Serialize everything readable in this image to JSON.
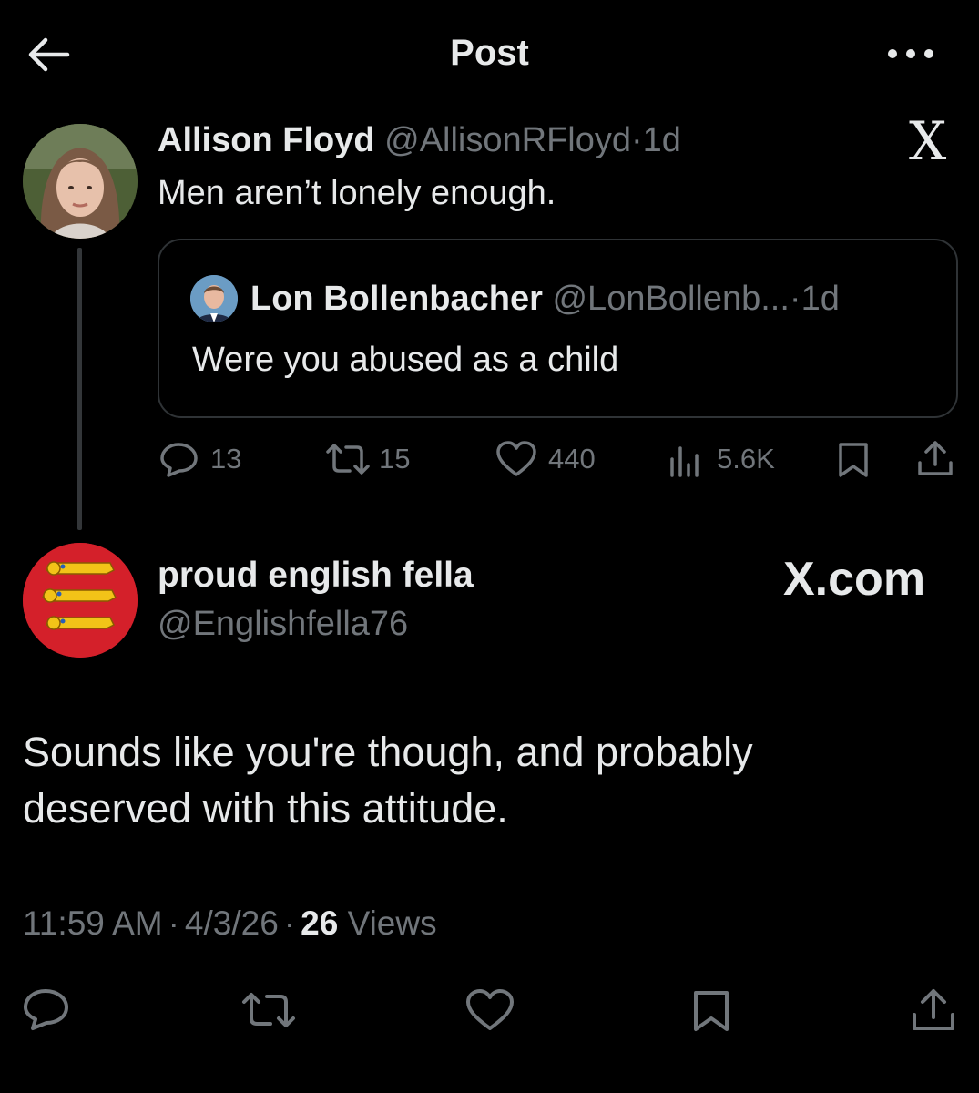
{
  "header": {
    "title": "Post",
    "back_icon": "arrow-left-icon",
    "more_icon": "more-dots-icon"
  },
  "parent_post": {
    "author_name": "Allison Floyd",
    "handle": "@AllisonRFloyd",
    "separator": "·",
    "age": "1d",
    "text": "Men aren’t lonely enough.",
    "quoted": {
      "author_name": "Lon Bollenbacher",
      "handle": "@LonBollenb...",
      "separator": "·",
      "age": "1d",
      "text": "Were you abused as a child"
    },
    "stats": {
      "replies": "13",
      "reposts": "15",
      "likes": "440",
      "views": "5.6K"
    }
  },
  "reply_post": {
    "author_name": "proud english fella",
    "handle": "@Englishfella76",
    "text": "Sounds like you're though, and probably deserved with this attitude.",
    "time": "11:59 AM",
    "sep1": "·",
    "date": "4/3/26",
    "sep2": "·",
    "views_count": "26",
    "views_label": "Views"
  },
  "watermarks": {
    "x_logo": "X",
    "x_com": "X.com"
  },
  "colors": {
    "background": "#000000",
    "text": "#e7e9ea",
    "muted": "#71767b",
    "border": "#2f3336"
  }
}
